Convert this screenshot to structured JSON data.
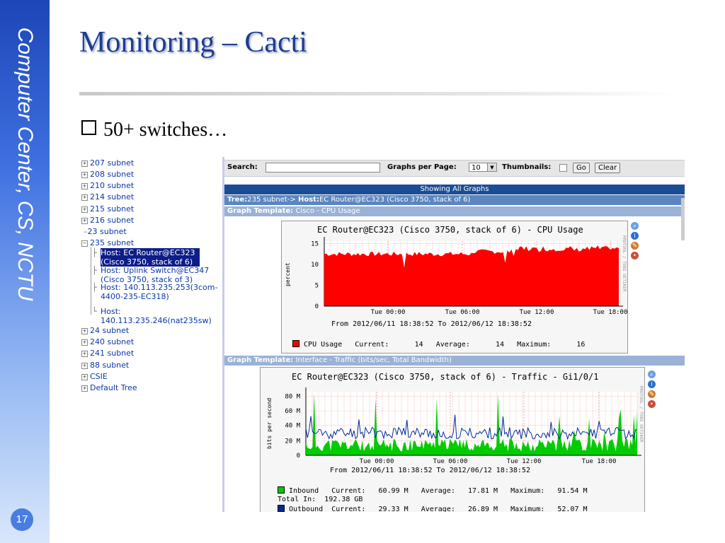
{
  "slide": {
    "side_text": "Computer Center, CS, NCTU",
    "title": "Monitoring – Cacti",
    "bullet": "50+ switches…",
    "page_number": "17"
  },
  "tree": {
    "items": [
      {
        "label": "207 subnet",
        "kind": "plus"
      },
      {
        "label": "208 subnet",
        "kind": "plus"
      },
      {
        "label": "210 subnet",
        "kind": "plus"
      },
      {
        "label": "214 subnet",
        "kind": "plus"
      },
      {
        "label": "215 subnet",
        "kind": "plus"
      },
      {
        "label": "216 subnet",
        "kind": "plus"
      },
      {
        "label": "23 subnet",
        "kind": "leaf"
      },
      {
        "label": "235 subnet",
        "kind": "minus"
      },
      {
        "label": "Host: EC Router@EC323 (Cisco 3750, stack of 6)",
        "kind": "host-selected"
      },
      {
        "label": "Host: Uplink Switch@EC347 (Cisco 3750, stack of 3)",
        "kind": "host"
      },
      {
        "label": "Host: 140.113.235.253(3com-4400-235-EC318)",
        "kind": "host"
      },
      {
        "label": "Host: 140.113.235.246(nat235sw)",
        "kind": "host"
      },
      {
        "label": "24 subnet",
        "kind": "plus"
      },
      {
        "label": "240 subnet",
        "kind": "plus"
      },
      {
        "label": "241 subnet",
        "kind": "plus"
      },
      {
        "label": "88 subnet",
        "kind": "plus"
      },
      {
        "label": "CSIE",
        "kind": "plus"
      },
      {
        "label": "Default Tree",
        "kind": "plus"
      }
    ]
  },
  "search": {
    "label": "Search:",
    "value": "",
    "graphs_per_page_label": "Graphs per Page:",
    "graphs_per_page_value": "10",
    "thumbnails_label": "Thumbnails:",
    "go_button": "Go",
    "clear_button": "Clear"
  },
  "header": {
    "showing": "Showing All Graphs",
    "tree_label": "Tree:",
    "tree_value": "235 subnet->",
    "host_label": "Host:",
    "host_value": "EC Router@EC323 (Cisco 3750, stack of 6)",
    "template1_label": "Graph Template:",
    "template1_value": "Cisco - CPU Usage",
    "template2_label": "Graph Template:",
    "template2_value": "Interface - Traffic (bits/sec, Total Bandwidth)"
  },
  "cpu_graph": {
    "title": "EC Router@EC323 (Cisco 3750, stack of 6) - CPU Usage",
    "ylabel": "percent",
    "side_label": "RRDTOOL / TOBI OETIKER",
    "yticks": [
      "15",
      "10",
      "5",
      "0"
    ],
    "xticks": [
      "Tue 00:00",
      "Tue 06:00",
      "Tue 12:00",
      "Tue 18:00"
    ],
    "from_to": "From 2012/06/11 18:38:52 To 2012/06/12 18:38:52",
    "legend": {
      "name": "CPU Usage",
      "current_label": "Current:",
      "current": "14",
      "average_label": "Average:",
      "average": "14",
      "maximum_label": "Maximum:",
      "maximum": "16"
    },
    "color": "#ff0000"
  },
  "traffic_graph": {
    "title": "EC Router@EC323 (Cisco 3750, stack of 6) - Traffic - Gi1/0/1",
    "ylabel": "bits per second",
    "side_label": "RRDTOOL / TOBI OETIKER",
    "yticks": [
      "80 M",
      "60 M",
      "40 M",
      "20 M",
      "0"
    ],
    "xticks": [
      "Tue 00:00",
      "Tue 06:00",
      "Tue 12:00",
      "Tue 18:00"
    ],
    "from_to": "From 2012/06/11 18:38:52 To 2012/06/12 18:38:52",
    "inbound": {
      "name": "Inbound",
      "current_label": "Current:",
      "current": "60.99 M",
      "average_label": "Average:",
      "average": "17.81 M",
      "maximum_label": "Maximum:",
      "maximum": "91.54 M",
      "total_label": "Total In:",
      "total": "192.38 GB",
      "color": "#00cc00"
    },
    "outbound": {
      "name": "Outbound",
      "current_label": "Current:",
      "current": "29.33 M",
      "average_label": "Average:",
      "average": "26.89 M",
      "maximum_label": "Maximum:",
      "maximum": "52.07 M",
      "color": "#002a97"
    }
  }
}
